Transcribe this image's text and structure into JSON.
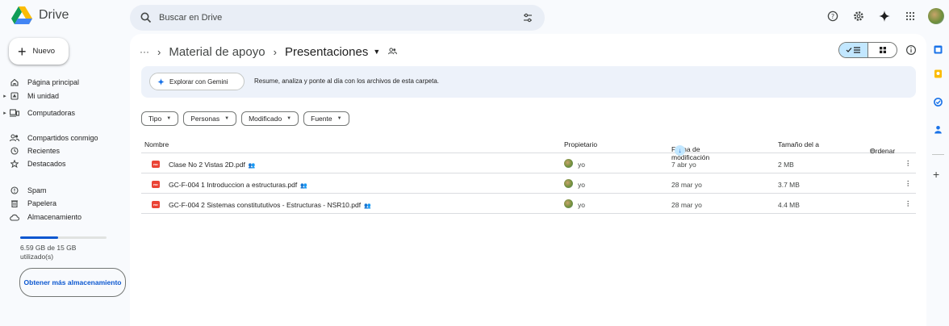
{
  "app": {
    "name": "Drive",
    "colors": {
      "accent": "#0b57d0",
      "selected": "#c2e7ff",
      "pdf": "#ea4335"
    }
  },
  "search": {
    "placeholder": "Buscar en Drive"
  },
  "sidebar": {
    "new_label": "Nuevo",
    "items": [
      {
        "label": "Página principal",
        "icon": "home-icon"
      },
      {
        "label": "Mi unidad",
        "icon": "my-drive-icon"
      },
      {
        "label": "Computadoras",
        "icon": "computer-icon"
      },
      {
        "label": "Compartidos conmigo",
        "icon": "people-icon"
      },
      {
        "label": "Recientes",
        "icon": "clock-icon"
      },
      {
        "label": "Destacados",
        "icon": "star-icon"
      },
      {
        "label": "Spam",
        "icon": "spam-icon"
      },
      {
        "label": "Papelera",
        "icon": "trash-icon"
      },
      {
        "label": "Almacenamiento",
        "icon": "cloud-icon"
      }
    ],
    "storage": {
      "text": "6.59 GB de 15 GB utilizado(s)",
      "used_fraction": 0.44
    },
    "get_more_label": "Obtener más almacenamiento"
  },
  "breadcrumb": {
    "dots": "···",
    "parent": "Material de apoyo",
    "current": "Presentaciones"
  },
  "gemini": {
    "button_label": "Explorar con Gemini",
    "text": "Resume, analiza y ponte al día con los archivos de esta carpeta."
  },
  "filters": [
    "Tipo",
    "Personas",
    "Modificado",
    "Fuente"
  ],
  "table": {
    "headers": {
      "name": "Nombre",
      "owner": "Propietario",
      "modified": "Fecha de modificación",
      "size": "Tamaño del a",
      "sort": "Ordenar"
    },
    "rows": [
      {
        "name": "Clase No 2 Vistas 2D.pdf",
        "owner": "yo",
        "modified": "7 abr yo",
        "size": "2 MB"
      },
      {
        "name": "GC-F-004 1 Introduccion a estructuras.pdf",
        "owner": "yo",
        "modified": "28 mar yo",
        "size": "3.7 MB"
      },
      {
        "name": "GC-F-004 2 Sistemas constitututivos - Estructuras - NSR10.pdf",
        "owner": "yo",
        "modified": "28 mar yo",
        "size": "4.4 MB"
      }
    ]
  }
}
